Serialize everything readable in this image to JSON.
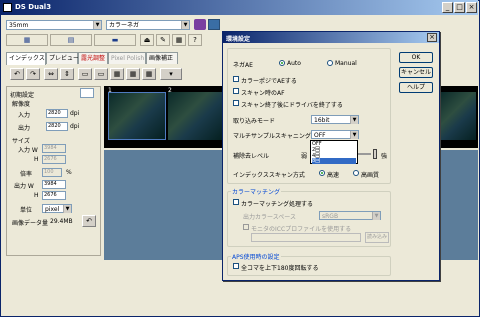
{
  "app": {
    "title": "DS Dual3"
  },
  "toolbar": {
    "film_type": "35mm",
    "film_mode": "カラーネガ"
  },
  "tabs": [
    {
      "label": "インデックス"
    },
    {
      "label": "プレビュー"
    },
    {
      "label": "露光調整"
    },
    {
      "label": "Pixel Polish"
    },
    {
      "label": "画像補正"
    }
  ],
  "left_panel": {
    "section_title": "初期設定",
    "resolution_label": "解像度",
    "input_label": "入力",
    "input_value": "2820",
    "input_unit": "dpi",
    "output_label": "出力",
    "output_value": "2820",
    "output_unit": "dpi",
    "size_label": "サイズ",
    "in_w_label": "入力 W",
    "in_w_value": "3984",
    "in_h_label": "H",
    "in_h_value": "2676",
    "scale_label": "倍率",
    "scale_value": "100",
    "scale_unit": "%",
    "out_w_label": "出力 W",
    "out_w_value": "3984",
    "out_h_label": "H",
    "out_h_value": "2676",
    "unit_label": "単位",
    "unit_value": "pixel",
    "data_size_label": "画像データ量",
    "data_size_value": "29.4MB"
  },
  "film_strip": {
    "frames": [
      "1",
      "2"
    ]
  },
  "dialog": {
    "title": "環境設定",
    "ok": "OK",
    "cancel": "キャンセル",
    "help": "ヘルプ",
    "nega_ae_label": "ネガAE",
    "auto_label": "Auto",
    "manual_label": "Manual",
    "check_carbon": "カラーポジでAEする",
    "check_scan_af": "スキャン時のAF",
    "check_eject": "スキャン終了後にドライバを終了する",
    "import_mode_label": "取り込みモード",
    "import_mode_value": "16bit",
    "multisample_label": "マルチサンプルスキャニング",
    "multisample_value": "OFF",
    "multisample_options": [
      "OFF",
      "2回",
      "4回",
      "8回"
    ],
    "multisample_selected_index": 3,
    "noise_label": "補除去レベル",
    "noise_low": "弱",
    "noise_high": "強",
    "index_scan_label": "インデックススキャン方式",
    "index_fast": "高速",
    "index_hq": "高画質",
    "color_matching_group": "カラーマッチング",
    "color_matching_check": "カラーマッチング処理する",
    "output_space_label": "出力カラースペース",
    "output_space_value": "sRGB",
    "monitor_profile_check": "モニタのICCプロファイルを使用する",
    "load_button": "読み込み",
    "aps_group": "APS使用時の設定",
    "aps_check": "全コマを上下180度回転する"
  }
}
